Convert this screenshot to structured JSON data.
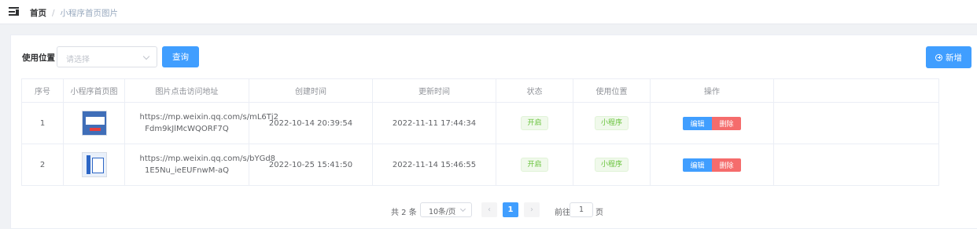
{
  "breadcrumb": {
    "home": "首页",
    "separator": "/",
    "current": "小程序首页图片"
  },
  "filter": {
    "label": "使用位置",
    "placeholder": "请选择",
    "query_label": "查询",
    "add_label": "新增"
  },
  "table": {
    "headers": [
      "序号",
      "小程序首页图",
      "图片点击访问地址",
      "创建时间",
      "更新时间",
      "状态",
      "使用位置",
      "操作"
    ],
    "rows": [
      {
        "index": "1",
        "url_line1": "https://mp.weixin.qq.com/s/mL6Tj2",
        "url_line2": "Fdm9kJlMcWQORF7Q",
        "created": "2022-10-14 20:39:54",
        "updated": "2022-11-11 17:44:34",
        "status": "开启",
        "location": "小程序",
        "edit": "编辑",
        "delete": "删除"
      },
      {
        "index": "2",
        "url_line1": "https://mp.weixin.qq.com/s/bYGd8",
        "url_line2": "1E5Nu_ieEUFnwM-aQ",
        "created": "2022-10-25 15:41:50",
        "updated": "2022-11-14 15:46:55",
        "status": "开启",
        "location": "小程序",
        "edit": "编辑",
        "delete": "删除"
      }
    ]
  },
  "pagination": {
    "total": "共 2 条",
    "page_size": "10条/页",
    "current_page": "1",
    "prev": "‹",
    "next": "›",
    "goto_label": "前往",
    "goto_value": "1",
    "page_suffix": "页"
  },
  "colors": {
    "primary": "#409eff",
    "danger": "#f56c6c",
    "success": "#67c23a"
  }
}
